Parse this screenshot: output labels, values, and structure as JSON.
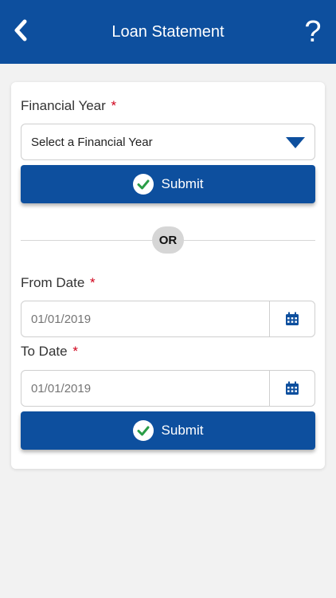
{
  "header": {
    "title": "Loan Statement",
    "help_label": "?"
  },
  "financial_year": {
    "label": "Financial Year",
    "required_mark": "*",
    "select_value": "Select a Financial Year"
  },
  "submit_1": {
    "label": "Submit"
  },
  "or_label": "OR",
  "from_date": {
    "label": "From Date",
    "required_mark": "*",
    "placeholder": "01/01/2019"
  },
  "to_date": {
    "label": "To Date",
    "required_mark": "*",
    "placeholder": "01/01/2019"
  },
  "submit_2": {
    "label": "Submit"
  },
  "colors": {
    "primary": "#0d4f9e",
    "required": "#d0021b",
    "check": "#2a9d46"
  }
}
